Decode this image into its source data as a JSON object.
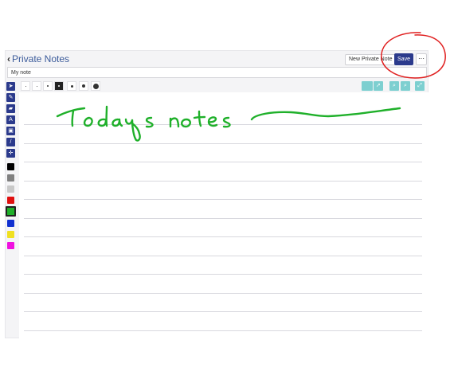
{
  "header": {
    "back_label": "Private Notes",
    "new_note_label": "New Private Note",
    "save_label": "Save",
    "more_label": "···"
  },
  "title_field": {
    "value": "My note"
  },
  "pen_sizes": [
    "tiny",
    "small",
    "medium",
    "large",
    "xlarge",
    "xxlarge",
    "huge"
  ],
  "selected_pen_size": "large",
  "side_tools": [
    "pointer-icon",
    "pencil-icon",
    "eraser-icon",
    "text-icon",
    "image-icon",
    "line-icon",
    "move-icon"
  ],
  "colors": [
    "#000000",
    "#808080",
    "#c8c8c8",
    "#e01010",
    "#1fb02a",
    "#1030d0",
    "#f0e020",
    "#f010e0"
  ],
  "selected_color": "#1fb02a",
  "right_tools": [
    "undo-icon",
    "redo-icon",
    "zoom-in-icon",
    "zoom-out-icon",
    "fullscreen-icon"
  ],
  "handwriting": {
    "text": "Todays notes",
    "color": "#1fb02a"
  },
  "annotation_color": "#e02020"
}
